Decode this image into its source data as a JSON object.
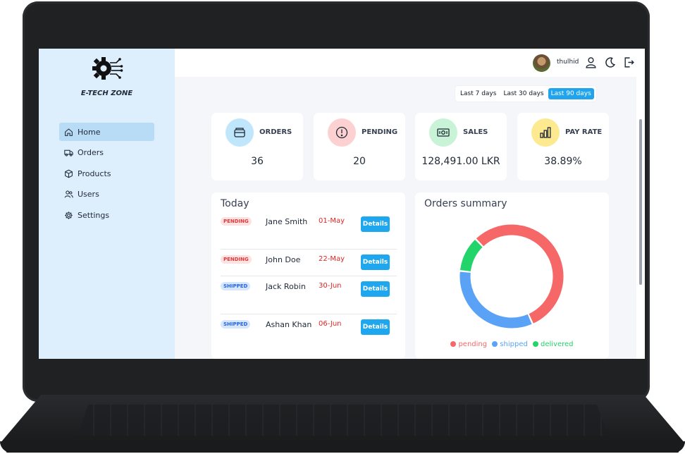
{
  "brand": {
    "name": "E-TECH ZONE"
  },
  "sidebar": {
    "items": [
      {
        "label": "Home",
        "icon": "home-icon",
        "active": true
      },
      {
        "label": "Orders",
        "icon": "truck-icon"
      },
      {
        "label": "Products",
        "icon": "box-icon"
      },
      {
        "label": "Users",
        "icon": "users-icon"
      },
      {
        "label": "Settings",
        "icon": "gear-icon"
      }
    ]
  },
  "topbar": {
    "username": "thulhid",
    "icons": [
      "user-icon",
      "moon-icon",
      "logout-icon"
    ]
  },
  "range": {
    "options": [
      "Last 7 days",
      "Last 30 days",
      "Last 90 days"
    ],
    "selected": "Last 90 days"
  },
  "stats": [
    {
      "label": "ORDERS",
      "value": "36",
      "icon": "wallet-icon",
      "color": "#bfe6fb"
    },
    {
      "label": "PENDING",
      "value": "20",
      "icon": "alert-icon",
      "color": "#fdd1d1"
    },
    {
      "label": "SALES",
      "value": "128,491.00 LKR",
      "icon": "money-icon",
      "color": "#c9f3d7"
    },
    {
      "label": "PAY RATE",
      "value": "38.89%",
      "icon": "bar-chart-icon",
      "color": "#fde98f"
    }
  ],
  "today": {
    "title": "Today",
    "details_label": "Details",
    "orders": [
      {
        "status": "PENDING",
        "customer": "Jane Smith",
        "date": "01-May"
      },
      {
        "status": "PENDING",
        "customer": "John Doe",
        "date": "22-May"
      },
      {
        "status": "SHIPPED",
        "customer": "Jack Robin",
        "date": "30-Jun"
      },
      {
        "status": "SHIPPED",
        "customer": "Ashan Khan",
        "date": "06-Jun"
      }
    ]
  },
  "summary": {
    "title": "Orders summary",
    "chart_data": {
      "type": "pie",
      "donut": true,
      "labels": [
        "pending",
        "shipped",
        "delivered"
      ],
      "values": [
        55.6,
        33.3,
        11.1
      ],
      "colors": [
        "#f66767",
        "#5aa2f6",
        "#22d46a"
      ],
      "legend": "bottom"
    }
  }
}
